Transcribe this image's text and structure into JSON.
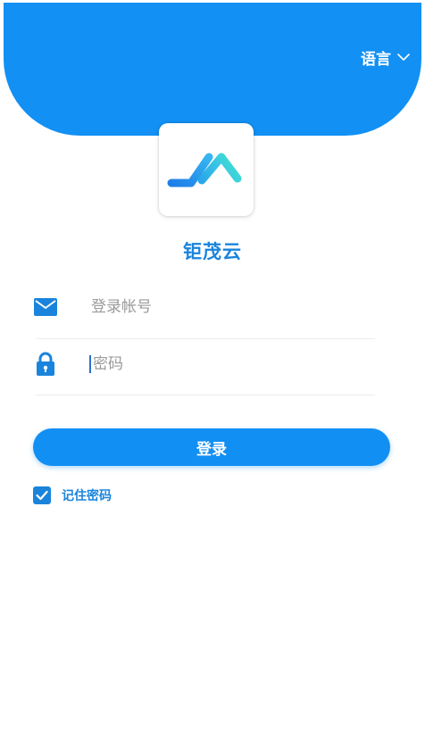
{
  "header": {
    "language_label": "语言"
  },
  "app": {
    "name": "钜茂云"
  },
  "form": {
    "account_placeholder": "登录帐号",
    "account_value": "",
    "password_placeholder": "密码",
    "password_value": "",
    "login_label": "登录",
    "remember_label": "记住密码",
    "remember_checked": true
  },
  "icons": {
    "language_chevron": "chevron-down-icon",
    "account": "mail-icon",
    "password": "lock-icon",
    "checkbox": "checkmark-icon"
  },
  "colors": {
    "primary": "#1290f4",
    "accent_text": "#1a84dc",
    "placeholder": "#9a9a9a",
    "divider": "#ececec",
    "background": "#ffffff"
  }
}
